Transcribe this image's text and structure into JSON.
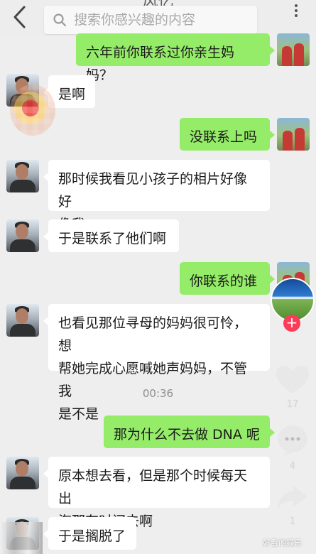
{
  "header": {
    "title": "风忆",
    "back_icon": "chevron-left-icon",
    "more_icon": "vertical-more-icon",
    "search_placeholder": "搜索你感兴趣的内容",
    "search_icon": "search-icon"
  },
  "messages": [
    {
      "side": "sent",
      "text": "六年前你联系过你亲生妈妈？"
    },
    {
      "side": "recv",
      "text": "是啊"
    },
    {
      "side": "sent",
      "text": "没联系上吗"
    },
    {
      "side": "recv",
      "text": "那时候我看见小孩子的相片好像好\n像我"
    },
    {
      "side": "recv",
      "text": "于是联系了他们啊"
    },
    {
      "side": "sent",
      "text": "你联系的谁"
    },
    {
      "side": "recv",
      "text": "也看见那位寻母的妈妈很可怜，想\n帮她完成心愿喊她声妈妈，不管我\n是不是"
    },
    {
      "side": "sent",
      "text": "那为什么不去做 DNA 呢"
    },
    {
      "side": "recv",
      "text": "原本想去看，但是那个时候每天出\n海那有时间去啊"
    },
    {
      "side": "recv",
      "text": "于是搁脱了"
    }
  ],
  "timestamp": "00:36",
  "overlay": {
    "like_count": "17",
    "comment_count": "4",
    "share_count": "1",
    "watermark": "好看的娱乐",
    "follow_label": "+",
    "like_icon": "heart-icon",
    "comment_icon": "comment-bubble-icon",
    "share_icon": "share-arrow-icon"
  },
  "colors": {
    "sent_bubble": "#95ec69",
    "received_bubble": "#ffffff",
    "background": "#eeeeee",
    "follow_button": "#fb3b57"
  }
}
